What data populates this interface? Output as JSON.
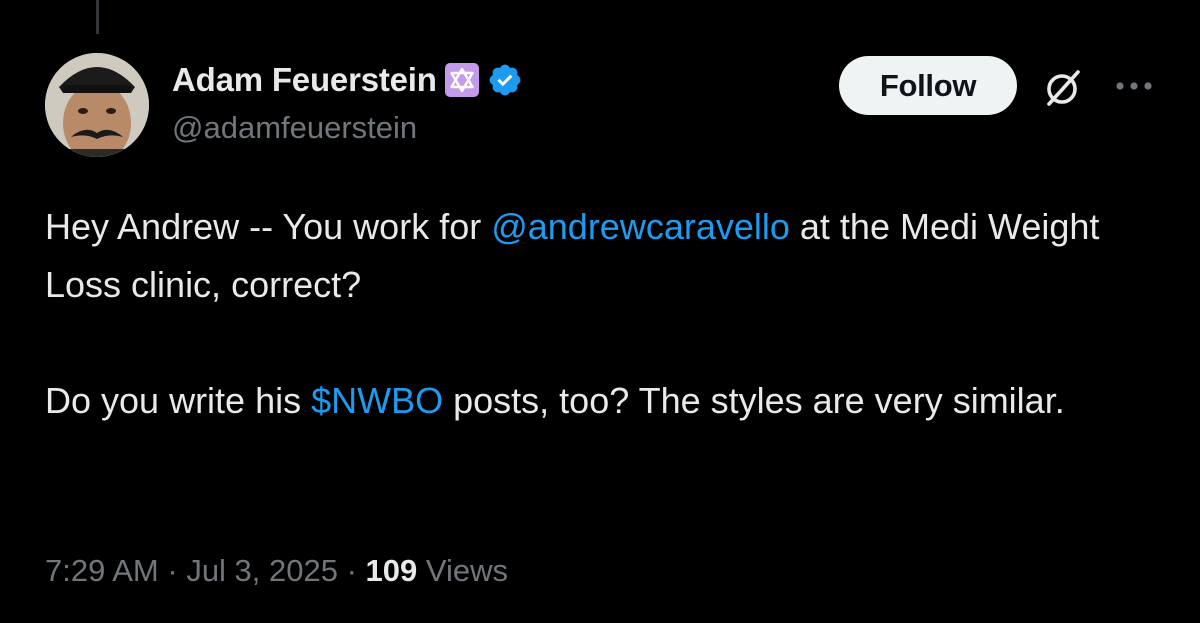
{
  "author": {
    "display_name": "Adam Feuerstein",
    "handle": "@adamfeuerstein",
    "badge_icon": "star-of-david-icon",
    "verified_icon": "verified-badge-icon",
    "verified_color": "#1d9bf0"
  },
  "actions": {
    "follow_label": "Follow",
    "grok_icon": "grok-icon",
    "more_icon": "more-icon"
  },
  "tweet": {
    "p1_part1": "Hey Andrew -- You work for ",
    "p1_mention": "@andrewcaravello",
    "p1_part2": " at the Medi Weight Loss clinic, correct?",
    "p2_part1": "Do you write his ",
    "p2_cashtag": "$NWBO",
    "p2_part2": " posts, too? The styles are very similar."
  },
  "meta": {
    "time": "7:29 AM",
    "separator": " · ",
    "date": "Jul 3, 2025",
    "views_count": "109",
    "views_label": " Views"
  },
  "colors": {
    "background": "#000000",
    "text": "#e7e9ea",
    "secondary": "#71767b",
    "link": "#1d9bf0",
    "follow_bg": "#eff3f4",
    "badge_bg": "#c39be8"
  }
}
